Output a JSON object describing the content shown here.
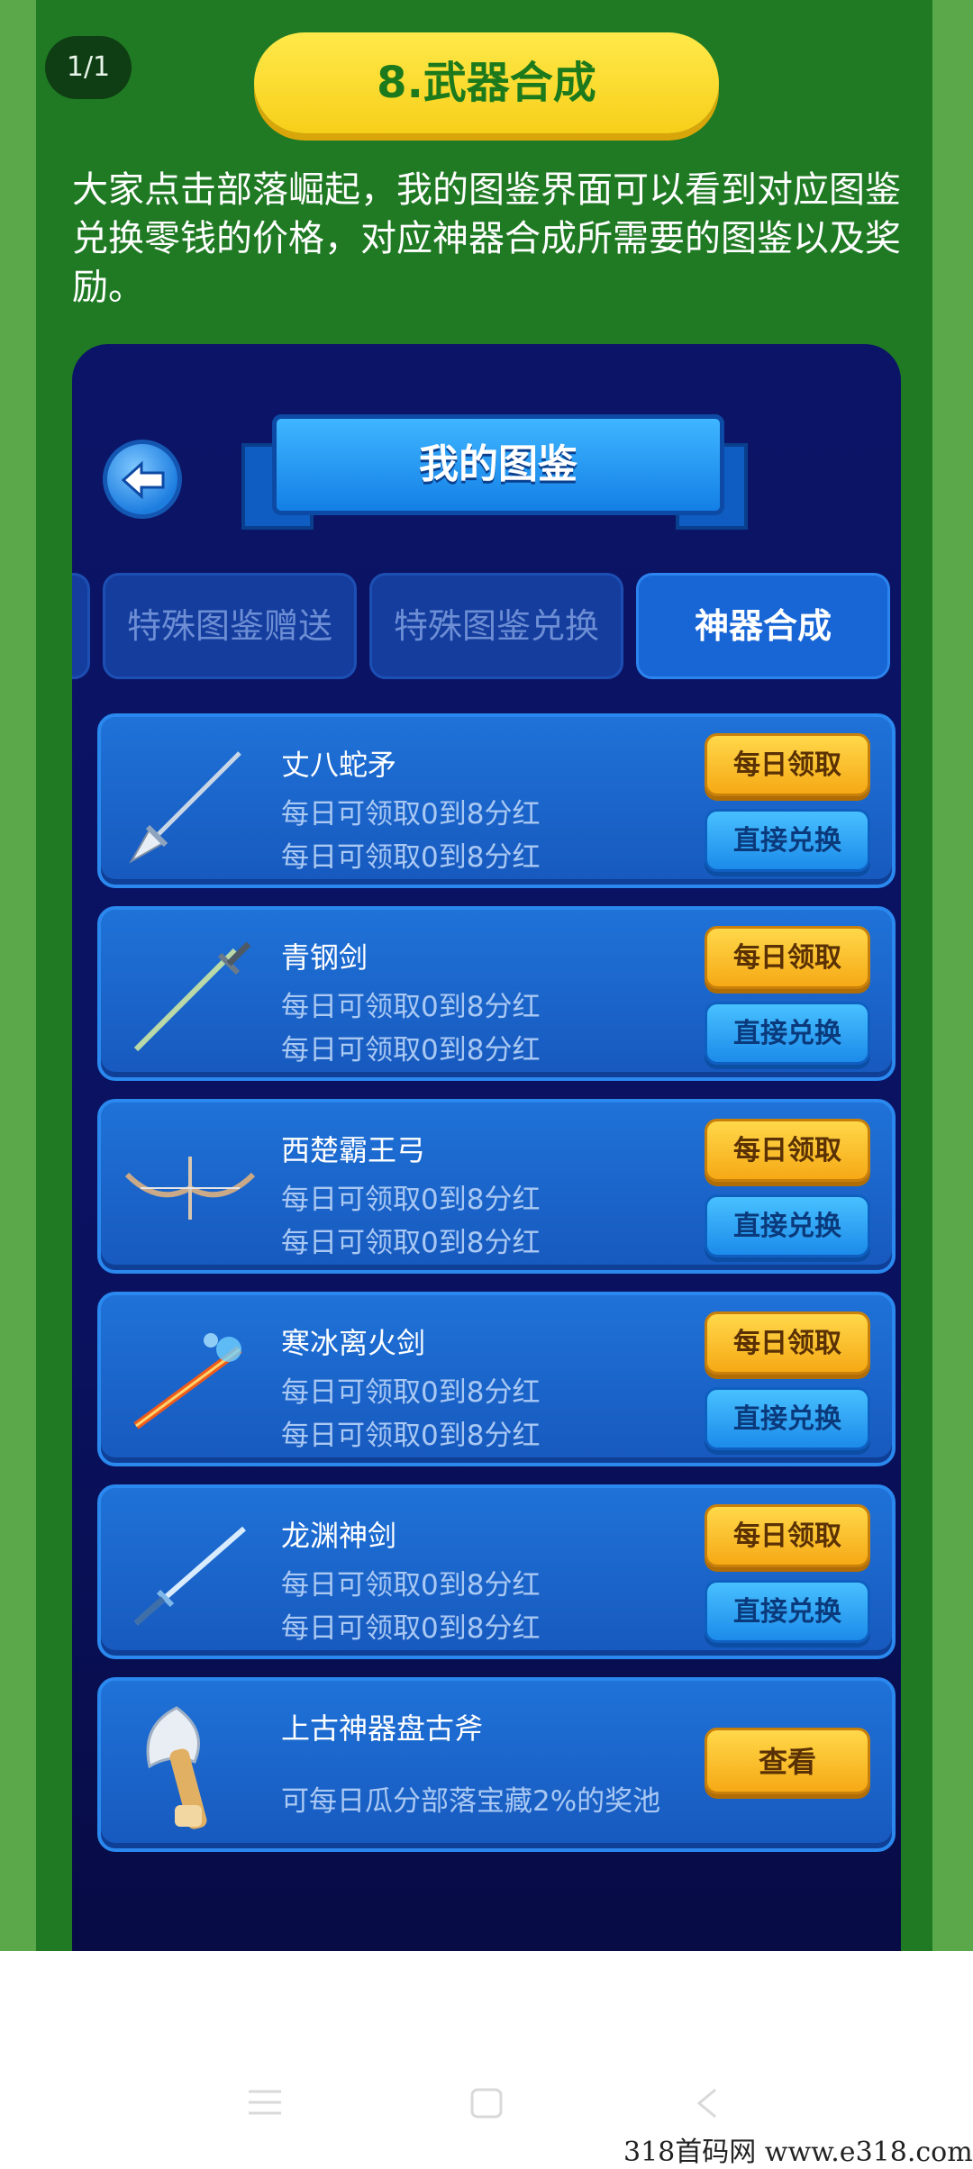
{
  "page_counter": "1/1",
  "section_title": "8.武器合成",
  "intro_text": "大家点击部落崛起，我的图鉴界面可以看到对应图鉴兑换零钱的价格，对应神器合成所需要的图鉴以及奖励。",
  "panel": {
    "title": "我的图鉴",
    "tabs": [
      {
        "label": "特殊图鉴赠送"
      },
      {
        "label": "特殊图鉴兑换"
      },
      {
        "label": "神器合成"
      }
    ],
    "active_tab": "神器合成",
    "items": [
      {
        "name": "丈八蛇矛",
        "line1": "每日可领取0到8分红",
        "line2": "每日可领取0到8分红",
        "btn_daily": "每日领取",
        "btn_exchange": "直接兑换"
      },
      {
        "name": "青钢剑",
        "line1": "每日可领取0到8分红",
        "line2": "每日可领取0到8分红",
        "btn_daily": "每日领取",
        "btn_exchange": "直接兑换"
      },
      {
        "name": "西楚霸王弓",
        "line1": "每日可领取0到8分红",
        "line2": "每日可领取0到8分红",
        "btn_daily": "每日领取",
        "btn_exchange": "直接兑换"
      },
      {
        "name": "寒冰离火剑",
        "line1": "每日可领取0到8分红",
        "line2": "每日可领取0到8分红",
        "btn_daily": "每日领取",
        "btn_exchange": "直接兑换"
      },
      {
        "name": "龙渊神剑",
        "line1": "每日可领取0到8分红",
        "line2": "每日可领取0到8分红",
        "btn_daily": "每日领取",
        "btn_exchange": "直接兑换"
      }
    ],
    "artifact": {
      "name": "上古神器盘古斧",
      "description": "可每日瓜分部落宝藏2%的奖池",
      "button": "查看"
    }
  },
  "watermark": "318首码网   www.e318.com",
  "colors": {
    "page_green": "#1f7a23",
    "title_yellow": "#ffe94a",
    "panel_navy": "#0b1466",
    "card_blue": "#1f72d8",
    "button_gold": "#f6a915",
    "button_blue": "#1c8bea"
  }
}
